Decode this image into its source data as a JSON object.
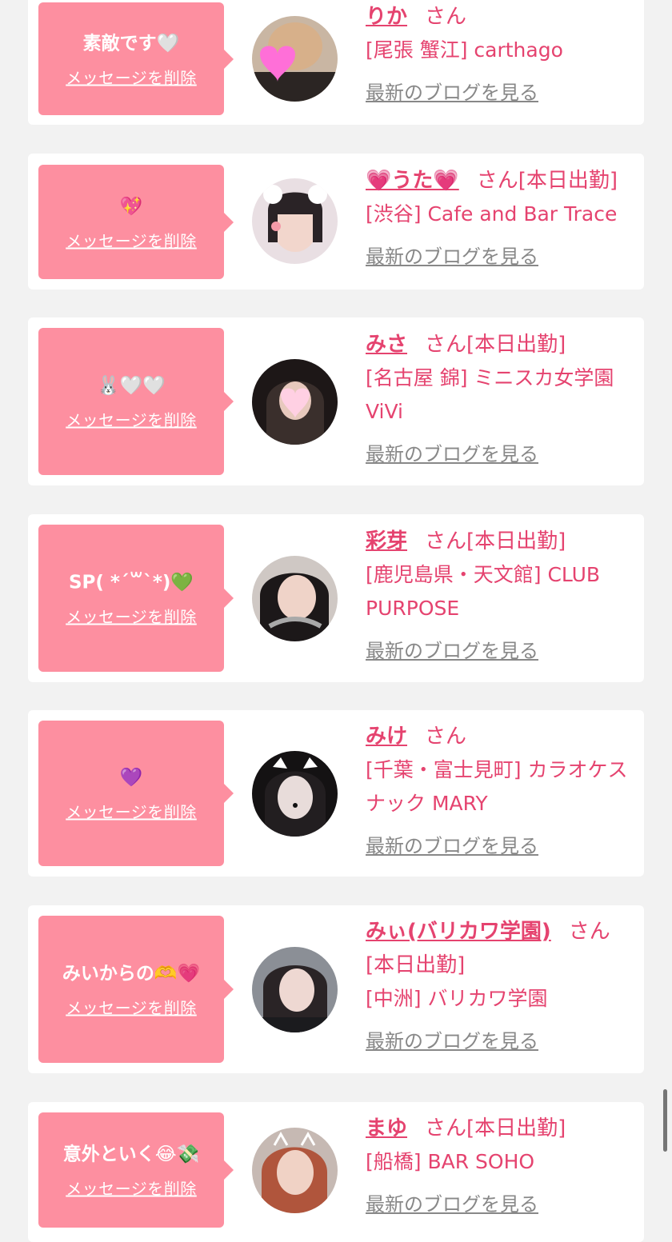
{
  "cards": [
    {
      "message": "素敵です🤍",
      "delete_label": "メッセージを削除",
      "name": "りか",
      "honorific": "さん",
      "status": "",
      "shop": "[尾張 蟹江] carthago",
      "blog_label": "最新のブログを見る"
    },
    {
      "message": "💖",
      "delete_label": "メッセージを削除",
      "name": "💗うた💗",
      "honorific": "さん",
      "status": "[本日出勤]",
      "shop": "[渋谷] Cafe and Bar Trace",
      "blog_label": "最新のブログを見る"
    },
    {
      "message": "🐰🤍🤍",
      "delete_label": "メッセージを削除",
      "name": "みさ",
      "honorific": "さん",
      "status": "[本日出勤]",
      "shop": "[名古屋 錦] ミニスカ女学園ViVi",
      "blog_label": "最新のブログを見る"
    },
    {
      "message": "SP( *´꒳`*)💚",
      "delete_label": "メッセージを削除",
      "name": "彩芽",
      "honorific": "さん",
      "status": "[本日出勤]",
      "shop": "[鹿児島県・天文館] CLUB PURPOSE",
      "blog_label": "最新のブログを見る"
    },
    {
      "message": "💜",
      "delete_label": "メッセージを削除",
      "name": "みけ",
      "honorific": "さん",
      "status": "",
      "shop": "[千葉・富士見町] カラオケスナック MARY",
      "blog_label": "最新のブログを見る"
    },
    {
      "message": "みいからの🫶💗",
      "delete_label": "メッセージを削除",
      "name": "みぃ(バリカワ学園)",
      "honorific": "さん",
      "status": "[本日出勤]",
      "shop": "[中洲] バリカワ学園",
      "blog_label": "最新のブログを見る"
    },
    {
      "message": "意外といく😂💸",
      "delete_label": "メッセージを削除",
      "name": "まゆ",
      "honorific": "さん",
      "status": "[本日出勤]",
      "shop": "[船橋] BAR SOHO",
      "blog_label": "最新のブログを見る"
    }
  ],
  "colors": {
    "accent": "#e5436f",
    "bubble": "#fd8fa0",
    "link_gray": "#888888",
    "background": "#f2f2f2"
  }
}
